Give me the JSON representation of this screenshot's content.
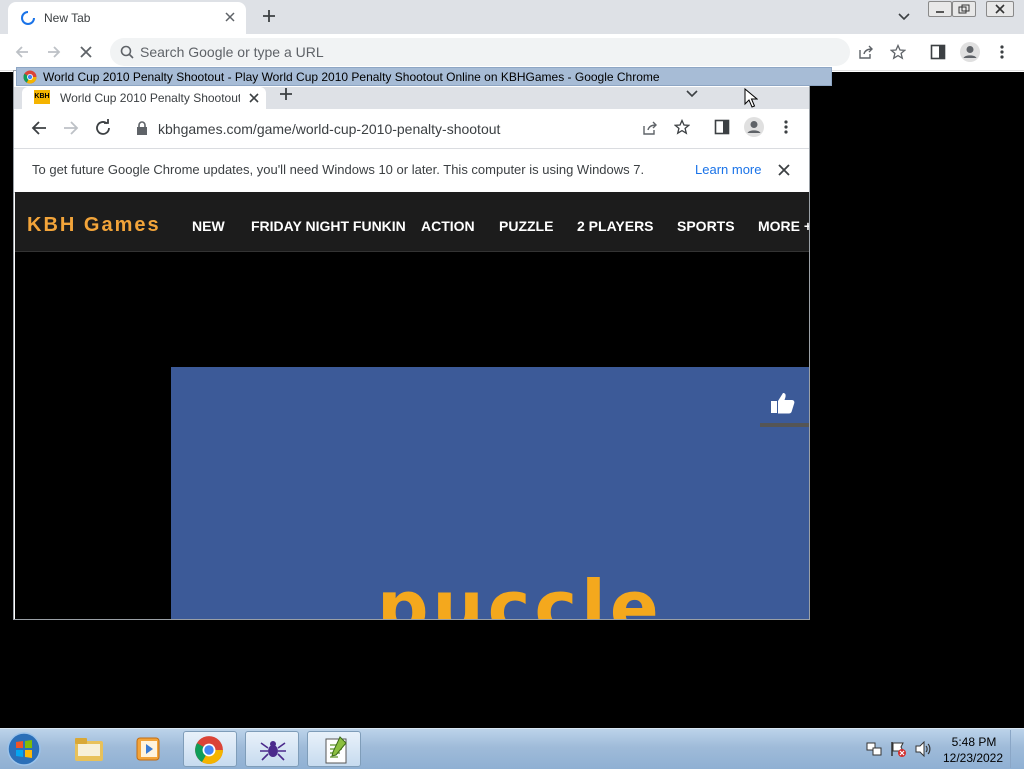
{
  "back_window": {
    "tab_title": "New Tab",
    "omnibox_placeholder": "Search Google or type a URL"
  },
  "front_window": {
    "window_title": "World Cup 2010 Penalty Shootout - Play World Cup 2010 Penalty Shootout Online on KBHGames - Google Chrome",
    "tab_title": "World Cup 2010 Penalty Shootout",
    "tab_favicon_text": "KBH",
    "url": "kbhgames.com/game/world-cup-2010-penalty-shootout"
  },
  "update_bar": {
    "message": "To get future Google Chrome updates, you'll need Windows 10 or later. This computer is using Windows 7.",
    "learn_more": "Learn more"
  },
  "site": {
    "logo": "KBH Games",
    "nav": [
      "NEW",
      "FRIDAY NIGHT FUNKIN",
      "ACTION",
      "PUZZLE",
      "2 PLAYERS",
      "SPORTS",
      "MORE +"
    ],
    "game_logo_text": "puccle"
  },
  "taskbar": {
    "time": "5:48 PM",
    "date": "12/23/2022"
  },
  "colors": {
    "site_accent": "#f2a43a",
    "game_bg": "#3c5a98",
    "link_blue": "#1a73e8"
  }
}
